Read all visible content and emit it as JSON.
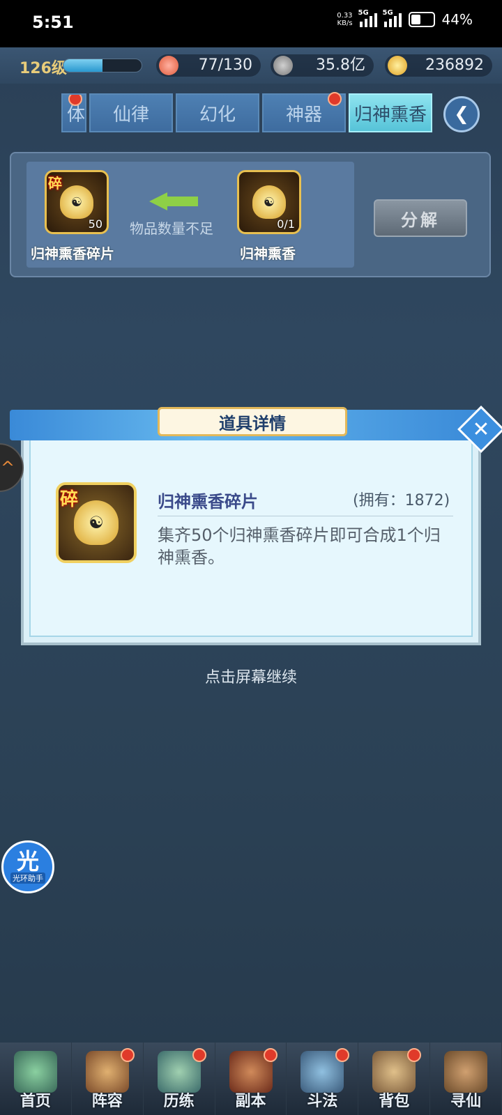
{
  "status": {
    "time": "5:51",
    "net_speed": "0.33",
    "net_unit": "KB/s",
    "sig1": "5G",
    "sig2": "5G",
    "battery": "44%"
  },
  "resources": {
    "level": "126级",
    "level_progress": 0.5,
    "stamina": "77/130",
    "coins": "35.8亿",
    "gold": "236892"
  },
  "tabs": [
    {
      "label": "体",
      "badge": true,
      "active": false
    },
    {
      "label": "仙律",
      "badge": false,
      "active": false
    },
    {
      "label": "幻化",
      "badge": false,
      "active": false
    },
    {
      "label": "神器",
      "badge": true,
      "active": false
    },
    {
      "label": "归神熏香",
      "badge": false,
      "active": true
    }
  ],
  "compose": {
    "fragment_name": "归神熏香碎片",
    "fragment_badge": "碎",
    "fragment_count": "50",
    "target_name": "归神熏香",
    "target_count": "0/1",
    "insufficient": "物品数量不足",
    "decompose_label": "分解"
  },
  "dialog": {
    "title": "道具详情",
    "item_name": "归神熏香碎片",
    "item_badge": "碎",
    "owned": "(拥有：1872)",
    "description": "集齐50个归神熏香碎片即可合成1个归神熏香。",
    "close_symbol": "✕"
  },
  "continue_text": "点击屏幕继续",
  "assistant": {
    "title": "光",
    "label": "光环助手"
  },
  "bottom_nav": [
    {
      "label": "首页",
      "badge": false
    },
    {
      "label": "阵容",
      "badge": true
    },
    {
      "label": "历练",
      "badge": true
    },
    {
      "label": "副本",
      "badge": true
    },
    {
      "label": "斗法",
      "badge": true
    },
    {
      "label": "背包",
      "badge": true
    },
    {
      "label": "寻仙",
      "badge": false
    }
  ],
  "colors": {
    "accent": "#56c3d8",
    "badge": "#e03a2a",
    "gold": "#e8c050"
  }
}
